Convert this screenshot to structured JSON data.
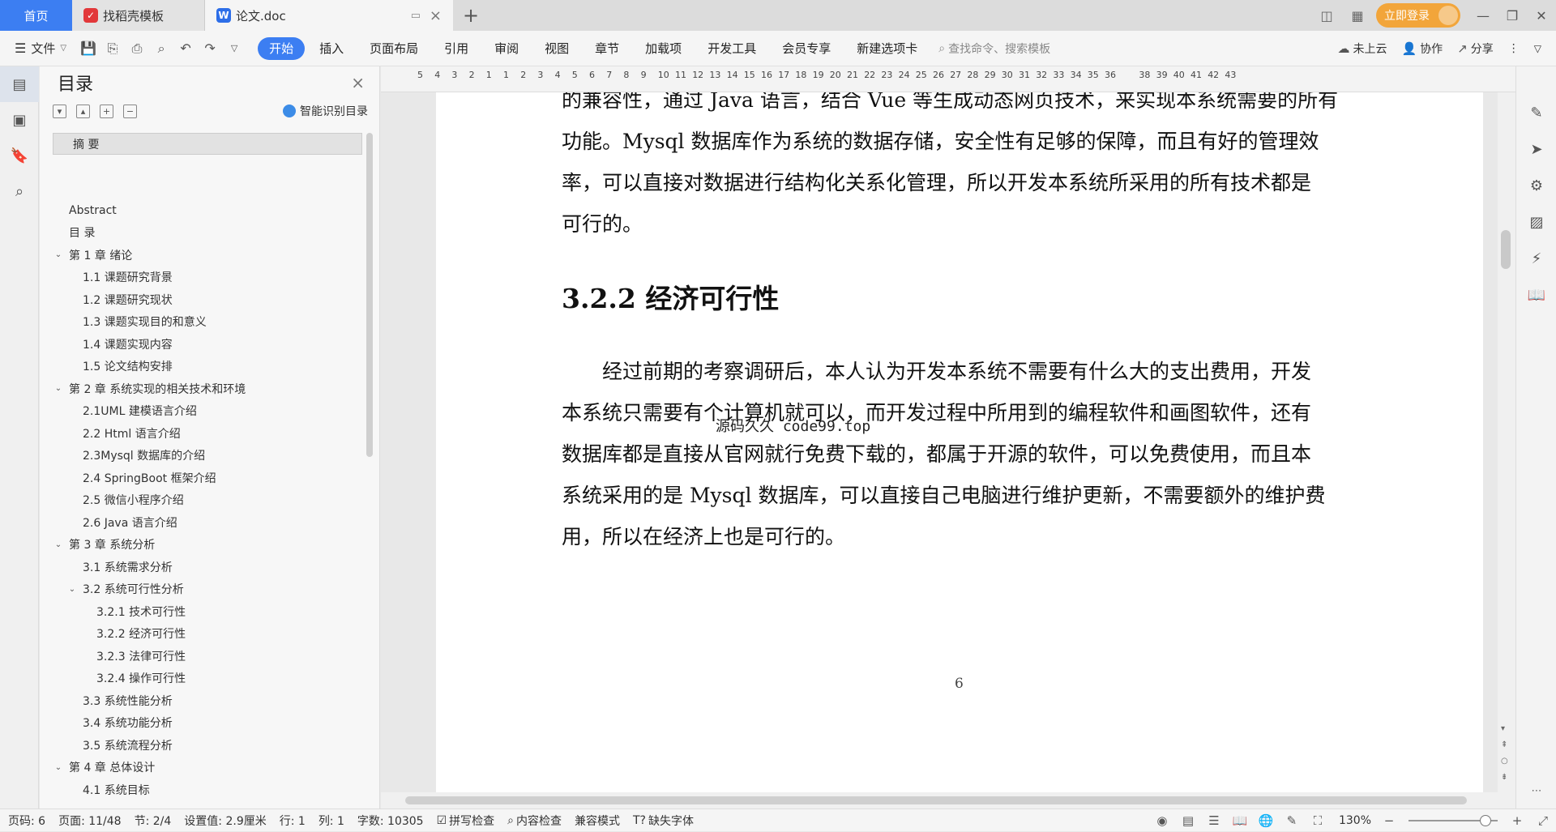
{
  "tabs": {
    "home": "首页",
    "daoke": "找稻壳模板",
    "doc": "论文.doc"
  },
  "titlebar": {
    "login": "立即登录"
  },
  "menubar": {
    "file": "文件",
    "tabs": [
      "开始",
      "插入",
      "页面布局",
      "引用",
      "审阅",
      "视图",
      "章节",
      "加载项",
      "开发工具",
      "会员专享",
      "新建选项卡"
    ],
    "search_placeholder": "查找命令、搜索模板",
    "cloud": "未上云",
    "collab": "协作",
    "share": "分享"
  },
  "toc": {
    "title": "目录",
    "smart": "智能识别目录",
    "items": [
      {
        "label": "摘  要",
        "level": 0,
        "caret": "",
        "selected": true
      },
      {
        "label": "",
        "level": 0,
        "caret": ""
      },
      {
        "label": "",
        "level": 0,
        "caret": ""
      },
      {
        "label": "Abstract",
        "level": 0,
        "caret": ""
      },
      {
        "label": "目  录",
        "level": 0,
        "caret": ""
      },
      {
        "label": "第 1 章  绪论",
        "level": 0,
        "caret": "v"
      },
      {
        "label": "1.1  课题研究背景",
        "level": 1,
        "caret": ""
      },
      {
        "label": "1.2 课题研究现状",
        "level": 1,
        "caret": ""
      },
      {
        "label": "1.3 课题实现目的和意义",
        "level": 1,
        "caret": ""
      },
      {
        "label": "1.4 课题实现内容",
        "level": 1,
        "caret": ""
      },
      {
        "label": "1.5 论文结构安排",
        "level": 1,
        "caret": ""
      },
      {
        "label": "第 2 章  系统实现的相关技术和环境",
        "level": 0,
        "caret": "v"
      },
      {
        "label": "2.1UML 建模语言介绍",
        "level": 1,
        "caret": ""
      },
      {
        "label": "2.2 Html 语言介绍",
        "level": 1,
        "caret": ""
      },
      {
        "label": "2.3Mysql 数据库的介绍",
        "level": 1,
        "caret": ""
      },
      {
        "label": "2.4 SpringBoot 框架介绍",
        "level": 1,
        "caret": ""
      },
      {
        "label": "2.5 微信小程序介绍",
        "level": 1,
        "caret": ""
      },
      {
        "label": "2.6 Java 语言介绍",
        "level": 1,
        "caret": ""
      },
      {
        "label": "第 3 章  系统分析",
        "level": 0,
        "caret": "v"
      },
      {
        "label": "3.1 系统需求分析",
        "level": 1,
        "caret": ""
      },
      {
        "label": "3.2 系统可行性分析",
        "level": 1,
        "caret": "v"
      },
      {
        "label": "3.2.1 技术可行性",
        "level": 2,
        "caret": ""
      },
      {
        "label": "3.2.2 经济可行性",
        "level": 2,
        "caret": ""
      },
      {
        "label": "3.2.3 法律可行性",
        "level": 2,
        "caret": ""
      },
      {
        "label": "3.2.4 操作可行性",
        "level": 2,
        "caret": ""
      },
      {
        "label": "3.3 系统性能分析",
        "level": 1,
        "caret": ""
      },
      {
        "label": "3.4 系统功能分析",
        "level": 1,
        "caret": ""
      },
      {
        "label": "3.5 系统流程分析",
        "level": 1,
        "caret": ""
      },
      {
        "label": "第 4 章  总体设计",
        "level": 0,
        "caret": "v"
      },
      {
        "label": "4.1 系统目标",
        "level": 1,
        "caret": ""
      }
    ]
  },
  "ruler": {
    "labels": [
      "5",
      "4",
      "3",
      "2",
      "1",
      "1",
      "2",
      "3",
      "4",
      "5",
      "6",
      "7",
      "8",
      "9",
      "10",
      "11",
      "12",
      "13",
      "14",
      "15",
      "16",
      "17",
      "18",
      "19",
      "20",
      "21",
      "22",
      "23",
      "24",
      "25",
      "26",
      "27",
      "28",
      "29",
      "30",
      "31",
      "32",
      "33",
      "34",
      "35",
      "36",
      "38",
      "39",
      "40",
      "41",
      "42",
      "43"
    ]
  },
  "document": {
    "para1": [
      "的兼容性，通过 Java 语言，结合 Vue 等生成动态网页技术，来实现本系统需要的所有",
      "功能。Mysql 数据库作为系统的数据存储，安全性有足够的保障，而且有好的管理效",
      "率，可以直接对数据进行结构化关系化管理，所以开发本系统所采用的所有技术都是",
      "可行的。"
    ],
    "heading": "3.2.2 经济可行性",
    "para2": [
      "　　经过前期的考察调研后，本人认为开发本系统不需要有什么大的支出费用，开发",
      "本系统只需要有个计算机就可以，而开发过程中所用到的编程软件和画图软件，还有",
      "数据库都是直接从官网就行免费下载的，都属于开源的软件，可以免费使用，而且本",
      "系统采用的是 Mysql 数据库，可以直接自己电脑进行维护更新，不需要额外的维护费",
      "用，所以在经济上也是可行的。"
    ],
    "watermark": "源码久久 code99.top",
    "page_number": "6"
  },
  "statusbar": {
    "page": "页码: 6",
    "pages": "页面: 11/48",
    "section": "节: 2/4",
    "setting": "设置值: 2.9厘米",
    "row": "行: 1",
    "col": "列: 1",
    "words": "字数: 10305",
    "spell": "拼写检查",
    "content": "内容检查",
    "compat": "兼容模式",
    "font_missing": "缺失字体",
    "zoom": "130%"
  }
}
